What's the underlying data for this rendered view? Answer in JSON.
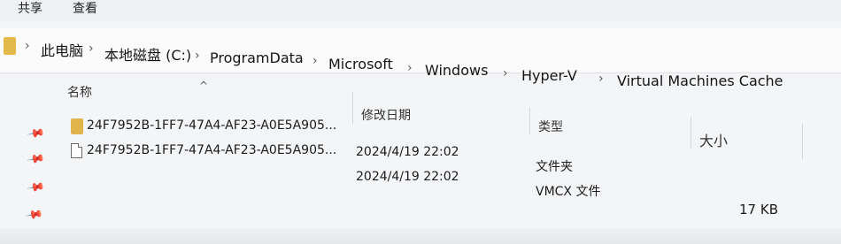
{
  "ribbon": {
    "share": "共享",
    "view": "查看"
  },
  "breadcrumb": {
    "separator": "›",
    "items": [
      "此电脑",
      "本地磁盘 (C:)",
      "ProgramData",
      "Microsoft",
      "Windows",
      "Hyper-V",
      "Virtual Machines Cache"
    ]
  },
  "columns": {
    "name": "名称",
    "date": "修改日期",
    "type": "类型",
    "size": "大小"
  },
  "pins": [
    "📌",
    "📌",
    "📌",
    "📌"
  ],
  "sort_glyph": "^",
  "files": [
    {
      "name": "24F7952B-1FF7-47A4-AF23-A0E5A905...",
      "date": "2024/4/19 22:02",
      "type": "文件夹",
      "size": "",
      "icon": "folder-icon"
    },
    {
      "name": "24F7952B-1FF7-47A4-AF23-A0E5A905...",
      "date": "2024/4/19 22:02",
      "type": "VMCX 文件",
      "size": "17 KB",
      "icon": "file-icon"
    }
  ],
  "colors": {
    "folder": "#e1b54c",
    "background": "#f4f5f7"
  }
}
